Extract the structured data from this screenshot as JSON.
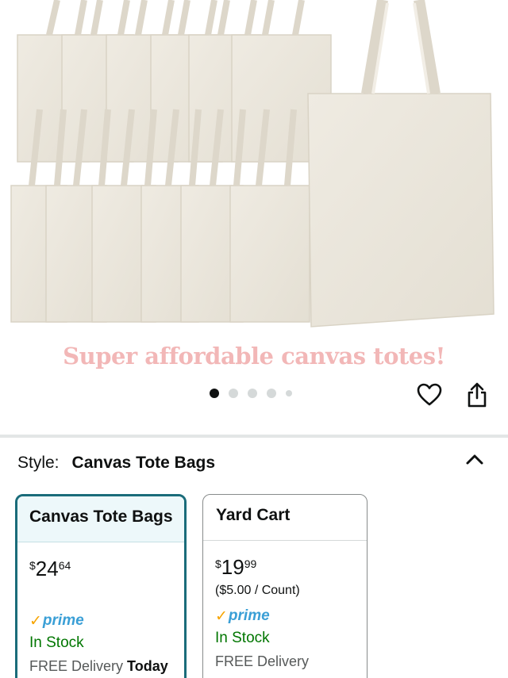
{
  "hero": {
    "caption": "Super affordable canvas totes!",
    "carousel": {
      "total": 5,
      "active_index": 0
    },
    "icons": {
      "favorite": "heart-icon",
      "share": "share-icon"
    }
  },
  "style": {
    "label": "Style:",
    "value": "Canvas Tote Bags",
    "collapse_icon": "chevron-up-icon"
  },
  "options": [
    {
      "name": "Canvas Tote Bags",
      "price_currency": "$",
      "price_whole": "24",
      "price_fraction": "64",
      "unit_price": "",
      "prime_check": "✓",
      "prime_label": "prime",
      "stock": "In Stock",
      "delivery_prefix": "FREE Delivery",
      "delivery_day": "Today",
      "selected": true
    },
    {
      "name": "Yard Cart",
      "price_currency": "$",
      "price_whole": "19",
      "price_fraction": "99",
      "unit_price": "($5.00 / Count)",
      "prime_check": "✓",
      "prime_label": "prime",
      "stock": "In Stock",
      "delivery_prefix": "FREE Delivery",
      "delivery_day": "",
      "selected": false
    }
  ],
  "colors": {
    "caption": "#f2b7b7",
    "selected_border": "#1a6c7a",
    "in_stock": "#007600",
    "prime_blue": "#3a9fd6",
    "prime_check": "#f7a400"
  }
}
